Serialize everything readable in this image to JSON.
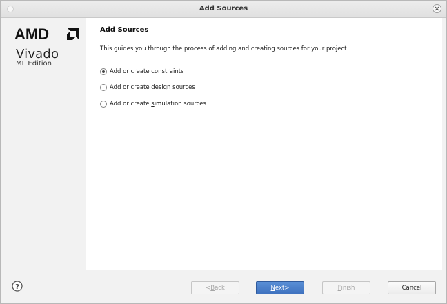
{
  "window": {
    "title": "Add Sources"
  },
  "brand": {
    "company": "AMD",
    "product": "Vivado",
    "edition": "ML Edition"
  },
  "page": {
    "heading": "Add Sources",
    "description": "This guides you through the process of adding and creating sources for your project"
  },
  "options": [
    {
      "pre": "Add or ",
      "mnemonic": "c",
      "post": "reate constraints",
      "selected": true
    },
    {
      "pre": "",
      "mnemonic": "A",
      "post": "dd or create design sources",
      "selected": false
    },
    {
      "pre": "Add or create ",
      "mnemonic": "s",
      "post": "imulation sources",
      "selected": false
    }
  ],
  "buttons": {
    "back": {
      "arrow": "< ",
      "mnemonic": "B",
      "rest": "ack",
      "enabled": false
    },
    "next": {
      "mnemonic": "N",
      "rest": "ext",
      "arrow": " >",
      "enabled": true
    },
    "finish": {
      "mnemonic": "F",
      "rest": "inish",
      "enabled": false
    },
    "cancel": {
      "label": "Cancel",
      "enabled": true
    }
  },
  "icons": {
    "close": "close-icon",
    "help": "help-icon",
    "logo": "amd-logo-icon"
  },
  "colors": {
    "primary_button": "#4a7fcc",
    "content_bg": "#ffffff",
    "panel_bg": "#f2f2f2"
  }
}
